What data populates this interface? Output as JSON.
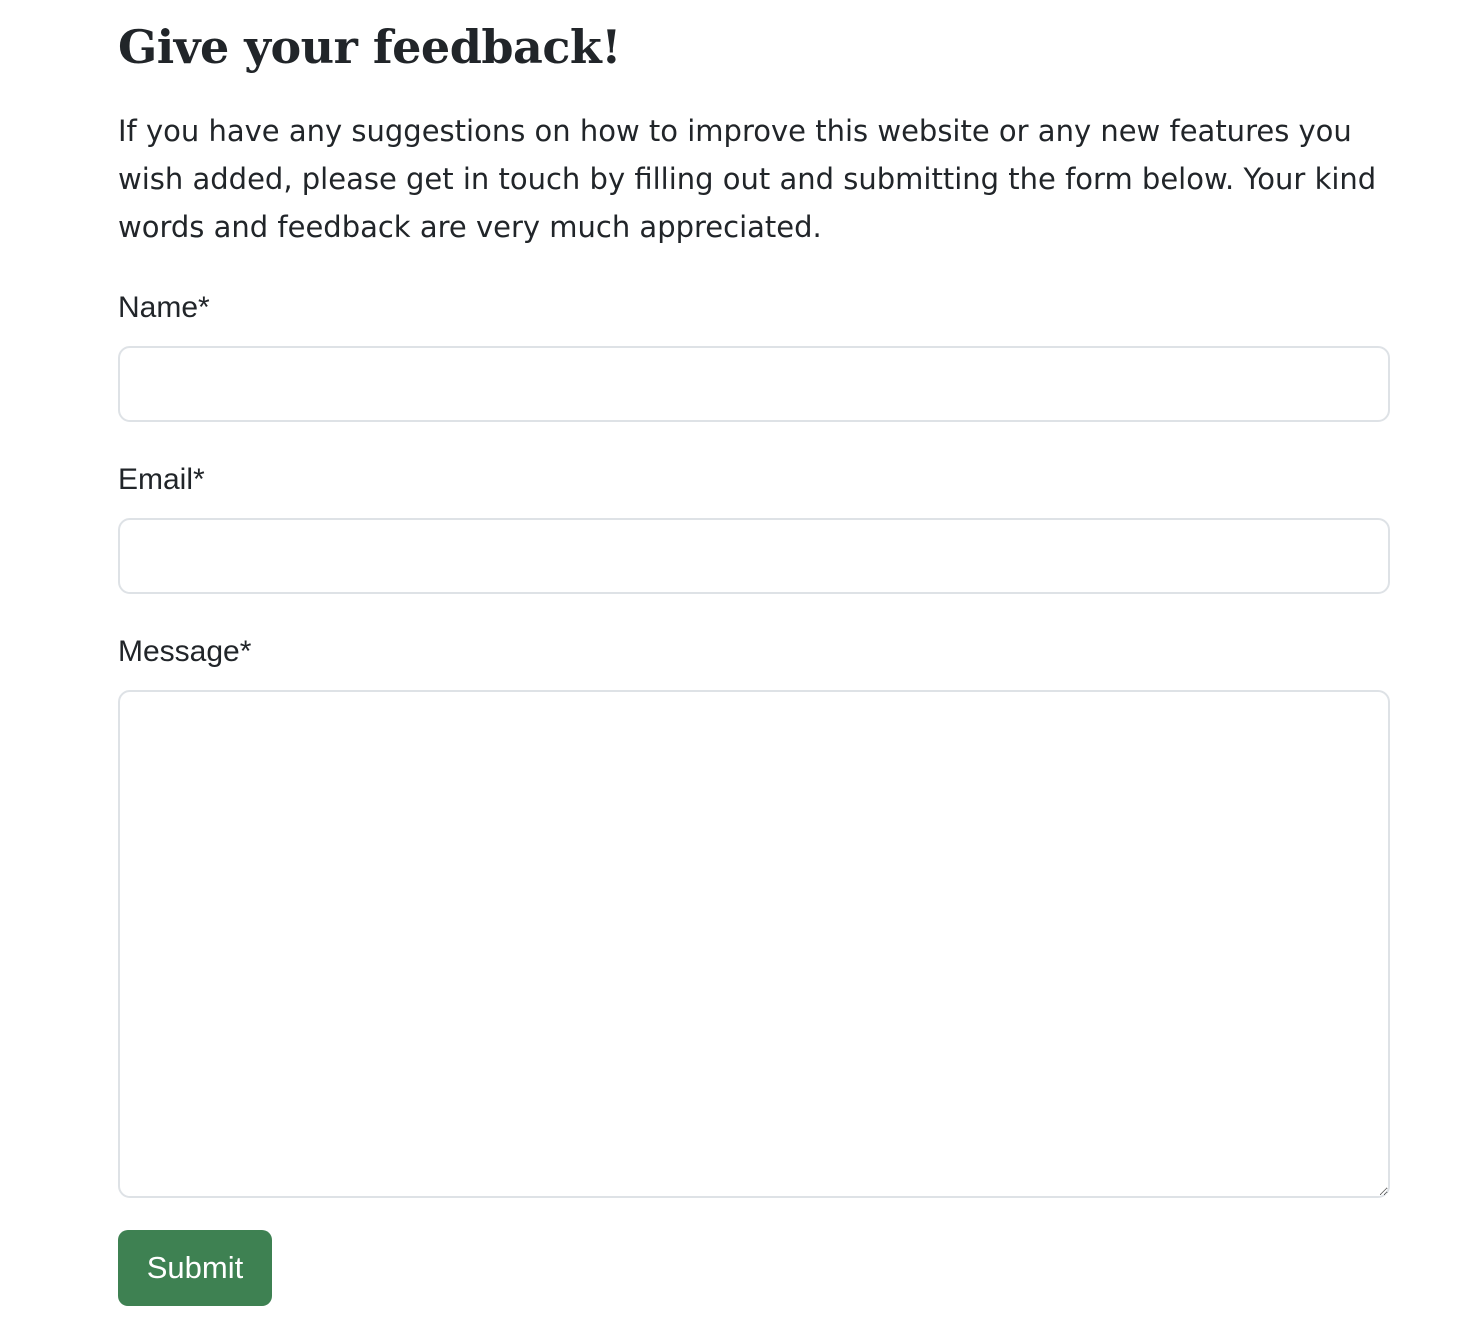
{
  "header": {
    "title": "Give your feedback!"
  },
  "intro": {
    "text": "If you have any suggestions on how to improve this website or any new features you wish added, please get in touch by filling out and submitting the form below. Your kind words and feedback are very much appreciated."
  },
  "form": {
    "name": {
      "label": "Name*",
      "value": "",
      "placeholder": ""
    },
    "email": {
      "label": "Email*",
      "value": "",
      "placeholder": ""
    },
    "message": {
      "label": "Message*",
      "value": "",
      "placeholder": ""
    },
    "submit_label": "Submit"
  },
  "colors": {
    "text": "#212529",
    "border": "#dee2e6",
    "submit_bg": "#3e8152",
    "submit_text": "#ffffff"
  }
}
